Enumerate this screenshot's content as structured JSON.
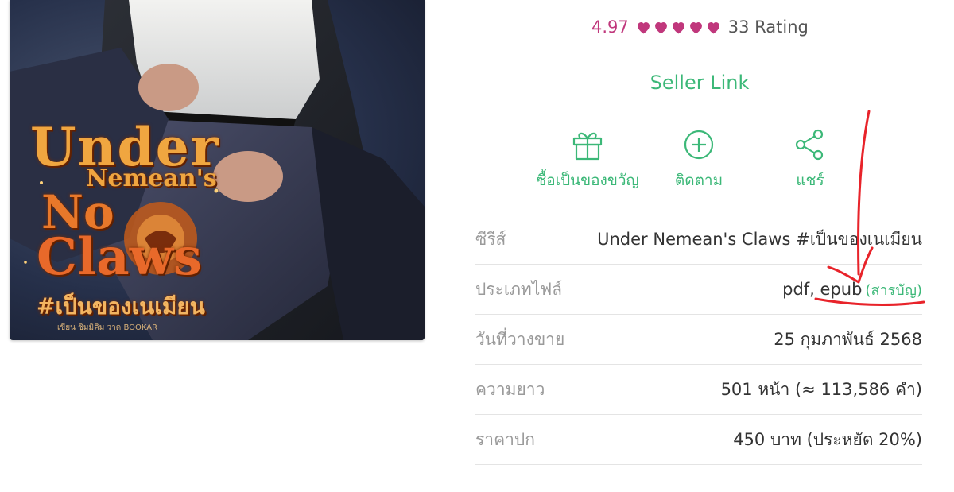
{
  "book": {
    "cover": {
      "title_line1": "Under",
      "title_line2": "Nemean's",
      "title_line3": "No",
      "title_line4": "Claws",
      "title_thai": "#เป็นของเนเมียน",
      "credit": "เขียน ชิมมิคิม วาด BOOKAR"
    }
  },
  "rating": {
    "value": "4.97",
    "heart_count": 5,
    "heart_color": "#c0377c",
    "count_label": "33 Rating"
  },
  "seller_link": "Seller Link",
  "actions": [
    {
      "icon": "gift-icon",
      "label": "ซื้อเป็นของขวัญ"
    },
    {
      "icon": "plus-circle-icon",
      "label": "ติดตาม"
    },
    {
      "icon": "share-icon",
      "label": "แชร์"
    }
  ],
  "info": [
    {
      "label": "ซีรีส์",
      "value": "Under Nemean's Claws #เป็นของเนเมียน"
    },
    {
      "label": "ประเภทไฟล์",
      "value": "pdf, epub",
      "link": "(สารบัญ)"
    },
    {
      "label": "วันที่วางขาย",
      "value": "25 กุมภาพันธ์ 2568"
    },
    {
      "label": "ความยาว",
      "value": "501 หน้า (≈ 113,586 คำ)"
    },
    {
      "label": "ราคาปก",
      "value": "450 บาท (ประหยัด 20%)"
    }
  ],
  "colors": {
    "accent_green": "#3cb878",
    "rating_pink": "#c0377c",
    "annotation_red": "#e8232a"
  }
}
